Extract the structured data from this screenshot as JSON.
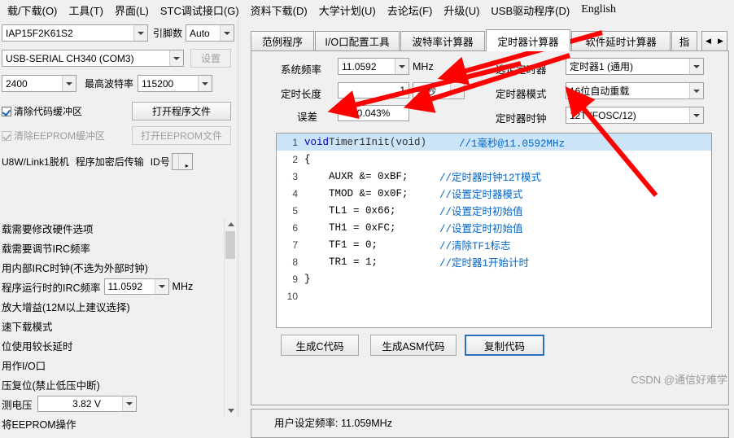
{
  "menu": {
    "items": [
      {
        "label": "载/下载(O)",
        "name": "menu-download"
      },
      {
        "label": "工具(T)",
        "name": "menu-tools"
      },
      {
        "label": "界面(L)",
        "name": "menu-interface"
      },
      {
        "label": "STC调试接口(G)",
        "name": "menu-stc-debug"
      },
      {
        "label": "资料下载(D)",
        "name": "menu-docs"
      },
      {
        "label": "大学计划(U)",
        "name": "menu-university"
      },
      {
        "label": "去论坛(F)",
        "name": "menu-forum"
      },
      {
        "label": "升级(U)",
        "name": "menu-upgrade"
      },
      {
        "label": "USB驱动程序(D)",
        "name": "menu-usb-driver"
      },
      {
        "label": "English",
        "name": "menu-english"
      }
    ]
  },
  "left": {
    "mcu_model": "IAP15F2K61S2",
    "pin_label": "引脚数",
    "pin_count": "Auto",
    "serial_port": "USB-SERIAL CH340 (COM3)",
    "settings_button": "设置",
    "baud_min": "2400",
    "baud_max_label": "最高波特率",
    "baud_max": "115200",
    "check_code_buffer": "清除代码缓冲区",
    "open_program_file": "打开程序文件",
    "check_eeprom_buffer": "清除EEPROM缓冲区",
    "open_eeprom_file": "打开EEPROM文件",
    "usb_link_label": "U8W/Link1脱机",
    "encrypt_label": "程序加密后传输",
    "id_label": "ID号",
    "options": [
      "载需要修改硬件选项",
      "载需要调节IRC频率",
      "用内部IRC时钟(不选为外部时钟)",
      "程序运行时的IRC频率",
      "放大增益(12M以上建议选择)",
      "速下载模式",
      "位使用较长延时",
      "用作I/O口",
      "压复位(禁止低压中断)",
      "测电压",
      "将EEPROM操作"
    ],
    "irc_freq": "11.0592",
    "irc_freq_unit": "MHz",
    "voltage_value": "3.82 V"
  },
  "right": {
    "tabs": [
      {
        "label": "范例程序",
        "selected": false
      },
      {
        "label": "I/O口配置工具",
        "selected": false
      },
      {
        "label": "波特率计算器",
        "selected": false
      },
      {
        "label": "定时器计算器",
        "selected": true
      },
      {
        "label": "软件延时计算器",
        "selected": false
      },
      {
        "label": "指",
        "selected": false
      }
    ],
    "form": {
      "sys_freq_label": "系统频率",
      "sys_freq_value": "11.0592",
      "sys_freq_unit": "MHz",
      "timer_len_label": "定时长度",
      "timer_len_value": "1",
      "timer_len_unit": "毫秒",
      "error_label": "误差",
      "error_value": "0.043%",
      "select_timer_label": "选定定时器",
      "select_timer_value": "定时器1 (通用)",
      "timer_mode_label": "定时器模式",
      "timer_mode_value": "16位自动重载",
      "timer_clock_label": "定时器时钟",
      "timer_clock_value": "12T (FOSC/12)"
    },
    "code": [
      {
        "n": "1",
        "kw": "void",
        "fn": " Timer1Init(void)",
        "cm": "//1毫秒@11.0592MHz",
        "hl": true
      },
      {
        "n": "2",
        "cd": "{"
      },
      {
        "n": "3",
        "cd": "    AUXR &= 0xBF;",
        "cm": "//定时器时钟12T模式"
      },
      {
        "n": "4",
        "cd": "    TMOD &= 0x0F;",
        "cm": "//设置定时器模式"
      },
      {
        "n": "5",
        "cd": "    TL1 = 0x66;",
        "cm": "//设置定时初始值"
      },
      {
        "n": "6",
        "cd": "    TH1 = 0xFC;",
        "cm": "//设置定时初始值"
      },
      {
        "n": "7",
        "cd": "    TF1 = 0;",
        "cm": "//清除TF1标志"
      },
      {
        "n": "8",
        "cd": "    TR1 = 1;",
        "cm": "//定时器1开始计时"
      },
      {
        "n": "9",
        "cd": "}"
      },
      {
        "n": "10",
        "cd": ""
      }
    ],
    "buttons": {
      "gen_c": "生成C代码",
      "gen_asm": "生成ASM代码",
      "copy": "复制代码"
    },
    "bottom_text": "用户设定频率: 11.059MHz"
  },
  "watermark": "CSDN @通信好难学",
  "colors": {
    "arrow": "#ff0000",
    "accent": "#2b6fc0",
    "highlight": "#cce4f7",
    "comment": "#0066cc",
    "keyword": "#0000c0"
  }
}
